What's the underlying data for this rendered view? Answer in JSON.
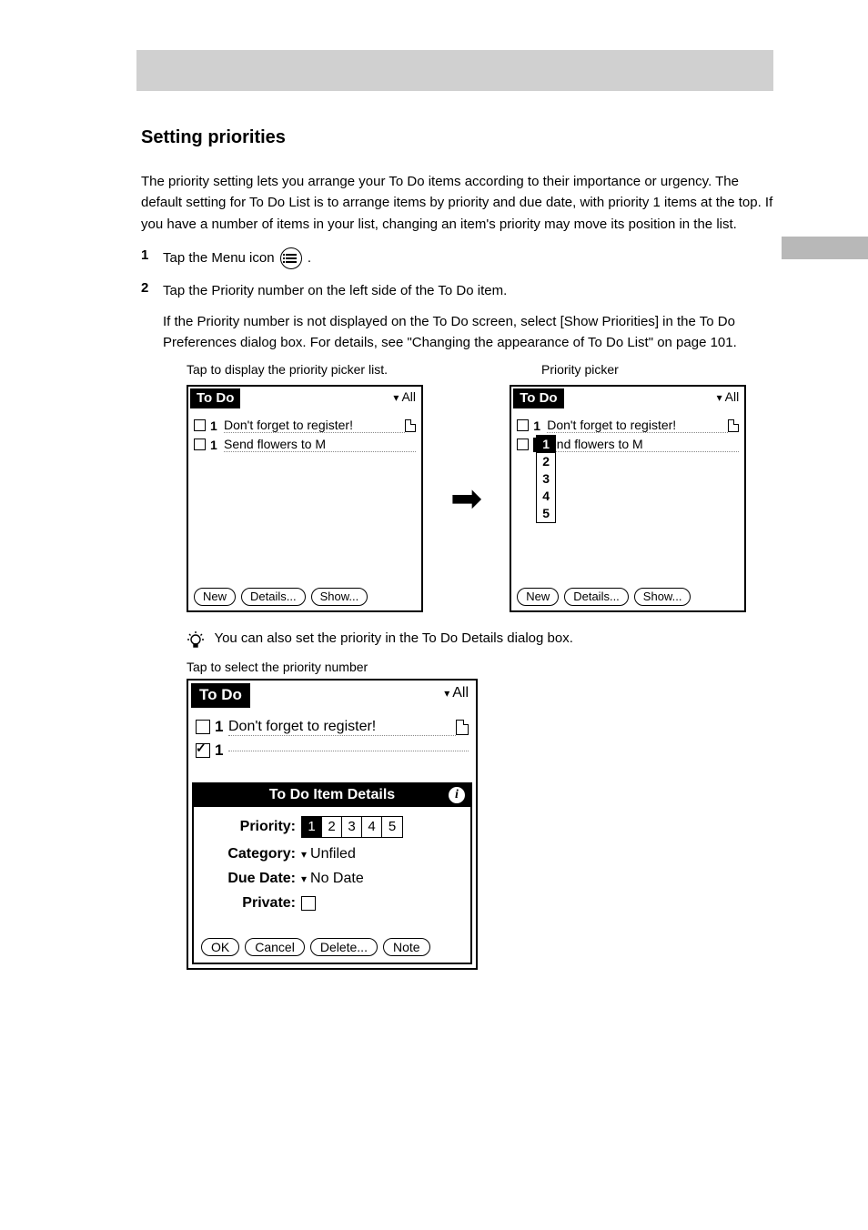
{
  "header": {
    "title": "Setting priorities"
  },
  "intro": "The priority setting lets you arrange your To Do items according to their importance or urgency. The default setting for To Do List is to arrange items by priority and due date, with priority 1 items at the top. If you have a number of items in your list, changing an item's priority may move its position in the list.",
  "steps": [
    {
      "num": "1",
      "text_a": "Tap the Menu icon ",
      "text_b": "."
    },
    {
      "num": "2",
      "text": "Tap the Priority number on the left side of the To Do item."
    }
  ],
  "note": "If the Priority number is not displayed on the To Do screen, select [Show Priorities] in the To Do Preferences dialog box. For details, see \"Changing the appearance of To Do List\" on page 101.",
  "captions": {
    "cap1": "Tap to display the priority picker list.",
    "cap2": "Priority picker",
    "cap3": "Tap to select the priority number"
  },
  "tip": "You can also set the priority in the To Do Details dialog box.",
  "palm": {
    "title": "To Do",
    "category": "All",
    "items": [
      {
        "pri": "1",
        "text": "Don't forget to register!",
        "note": true
      },
      {
        "pri": "1",
        "text": "Send flowers to M"
      }
    ],
    "buttons": {
      "new": "New",
      "details": "Details...",
      "show": "Show..."
    },
    "popup": [
      "1",
      "2",
      "3",
      "4",
      "5"
    ],
    "details": {
      "title": "To Do Item Details",
      "priority_label": "Priority:",
      "priorities": [
        "1",
        "2",
        "3",
        "4",
        "5"
      ],
      "category_label": "Category:",
      "category_value": "Unfiled",
      "duedate_label": "Due Date:",
      "duedate_value": "No Date",
      "private_label": "Private:",
      "buttons": {
        "ok": "OK",
        "cancel": "Cancel",
        "delete": "Delete...",
        "note": "Note"
      }
    }
  }
}
